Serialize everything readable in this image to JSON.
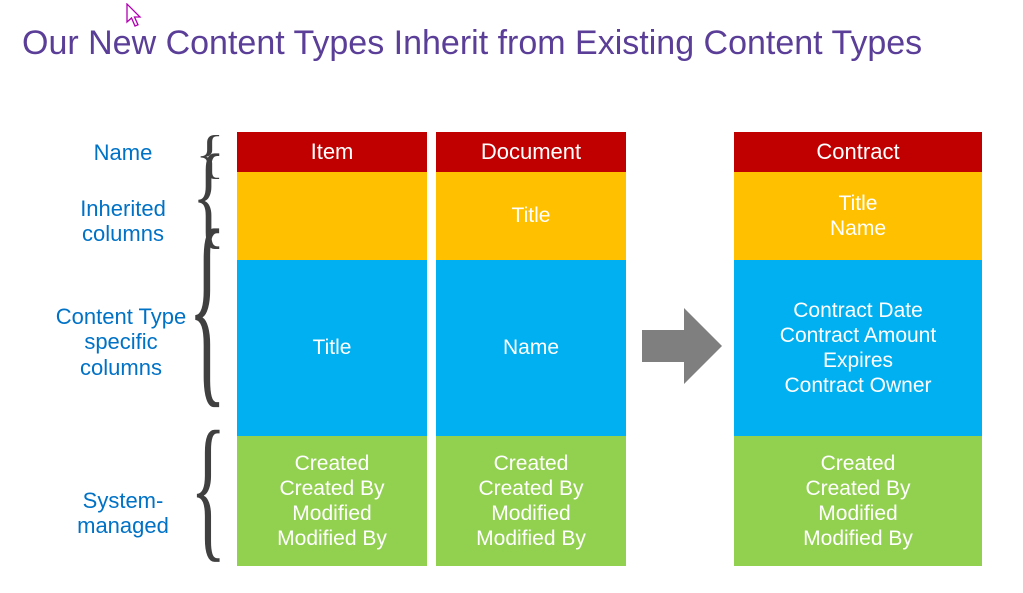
{
  "title": "Our New Content Types Inherit from Existing Content Types",
  "row_labels": {
    "name": "Name",
    "inherited_line1": "Inherited",
    "inherited_line2": "columns",
    "specific_line1": "Content Type",
    "specific_line2": "specific",
    "specific_line3": "columns",
    "system_line1": "System-",
    "system_line2": "managed"
  },
  "columns": {
    "item": {
      "name": "Item",
      "inherited": [],
      "specific": [
        "Title"
      ],
      "system": [
        "Created",
        "Created By",
        "Modified",
        "Modified By"
      ]
    },
    "document": {
      "name": "Document",
      "inherited": [
        "Title"
      ],
      "specific": [
        "Name"
      ],
      "system": [
        "Created",
        "Created By",
        "Modified",
        "Modified By"
      ]
    },
    "contract": {
      "name": "Contract",
      "inherited": [
        "Title",
        "Name"
      ],
      "specific": [
        "Contract Date",
        "Contract Amount",
        "Expires",
        "Contract Owner"
      ],
      "system": [
        "Created",
        "Created By",
        "Modified",
        "Modified By"
      ]
    }
  },
  "colors": {
    "title": "#5a3e97",
    "row_label": "#0072c6",
    "name_row": "#c00000",
    "inherited_row": "#ffc000",
    "specific_row": "#00b0f0",
    "system_row": "#92d050",
    "arrow": "#7f7f7f"
  }
}
